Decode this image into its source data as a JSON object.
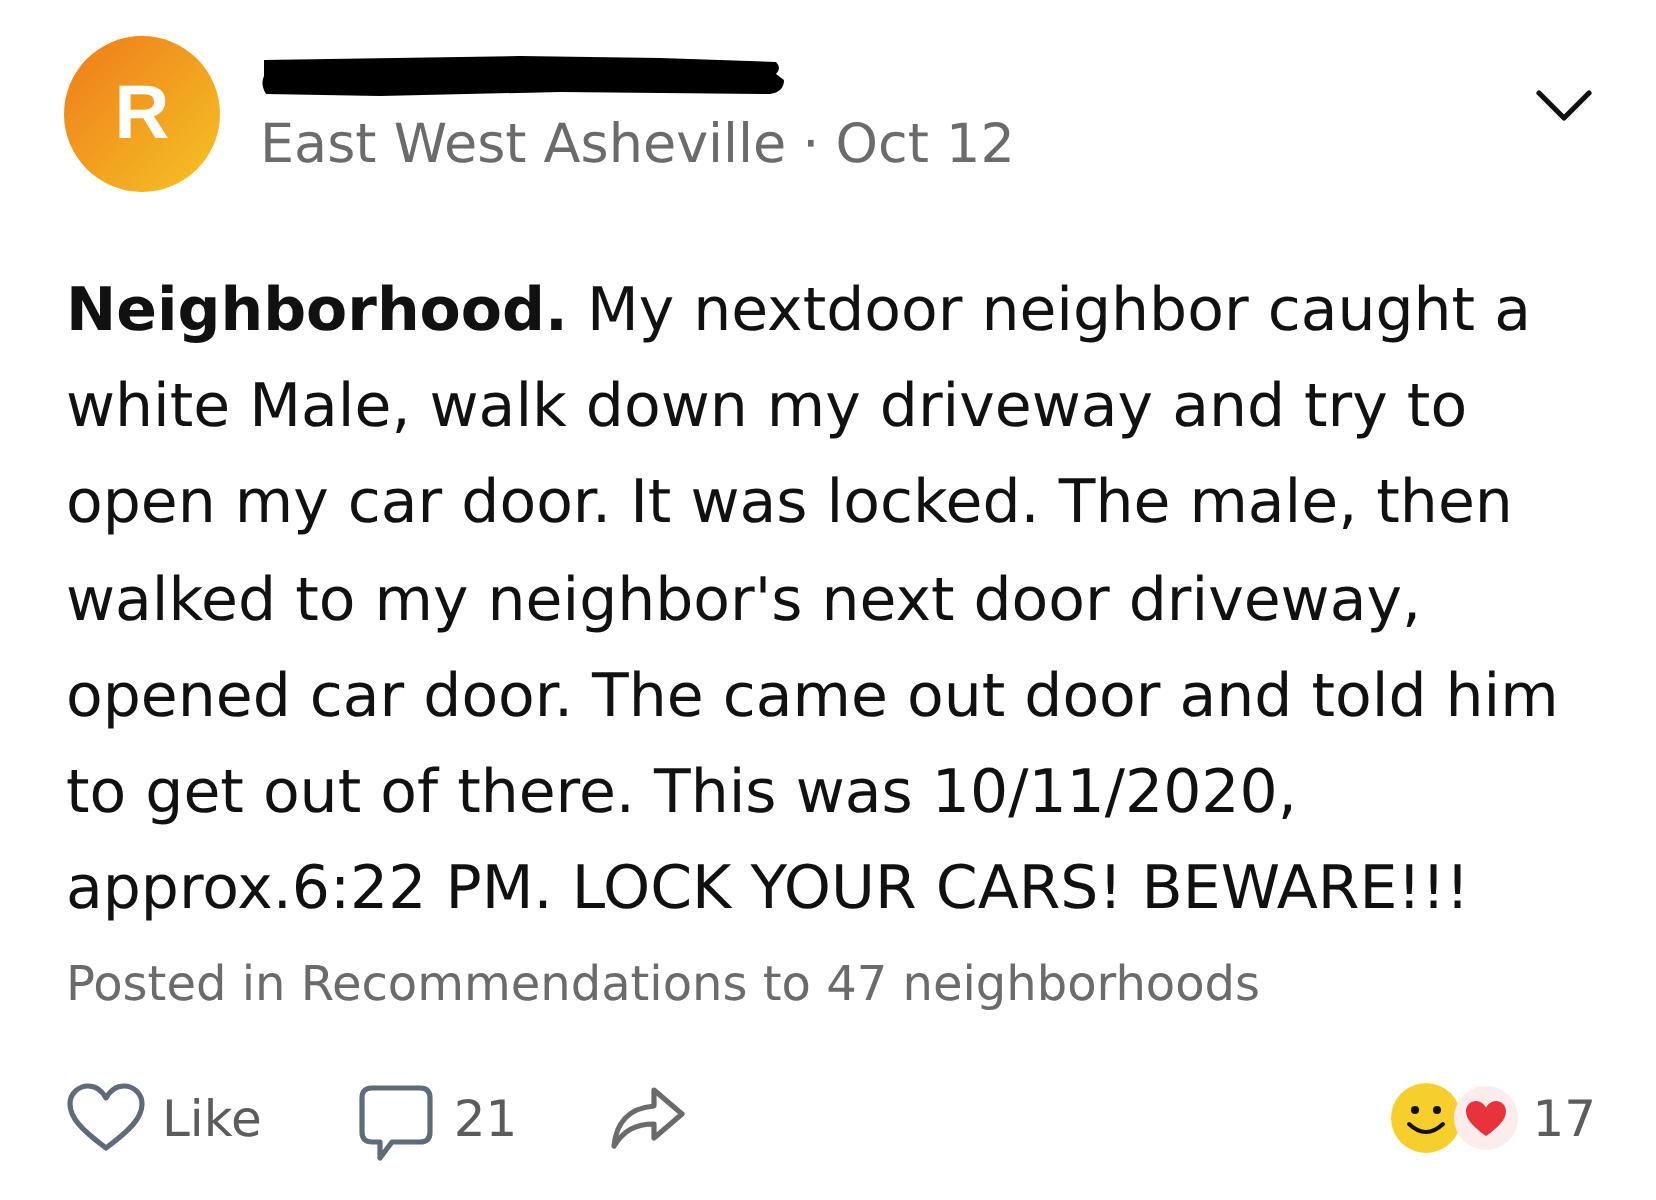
{
  "post": {
    "avatar": {
      "initial": "R"
    },
    "location": "East West Asheville",
    "separator": "·",
    "date": "Oct 12",
    "body": "**Neighborhood.** My nextdoor neighbor caught a white Male, walk down my driveway and try to open my car door. It was locked. The male, then walked to my neighbor's next door driveway, opened car door. The came out door and told him to get out of there. This was 10/11/2020, approx.6:22 PM. LOCK YOUR CARS! BEWARE!!!",
    "posted_in": "Posted in Recommendations to 47 neighborhoods",
    "actions": [
      {
        "kind": "like",
        "label": "Like",
        "liked": false
      },
      {
        "kind": "comment",
        "label": "21"
      },
      {
        "kind": "share"
      }
    ],
    "reactions": {
      "count": "17"
    }
  }
}
